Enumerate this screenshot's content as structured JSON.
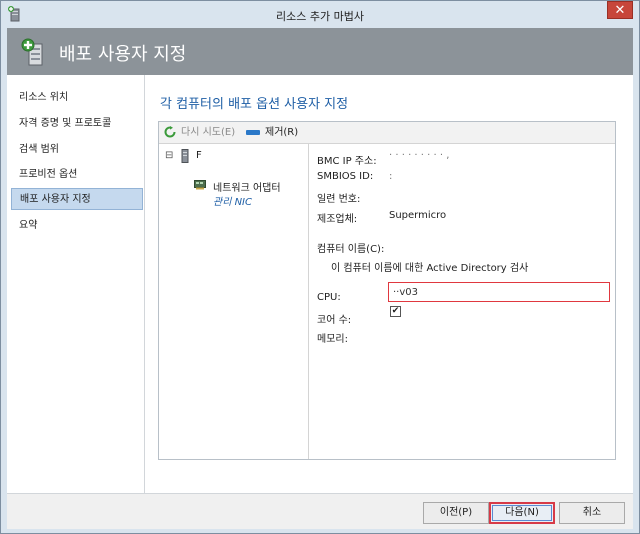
{
  "window": {
    "title": "리소스 추가 마법사",
    "close_label": "✕"
  },
  "header": {
    "title": "배포 사용자 지정"
  },
  "nav": {
    "items": [
      {
        "label": "리소스 위치"
      },
      {
        "label": "자격 증명 및 프로토콜"
      },
      {
        "label": "검색 범위"
      },
      {
        "label": "프로비전 옵션"
      },
      {
        "label": "배포 사용자 지정"
      },
      {
        "label": "요약"
      }
    ]
  },
  "main": {
    "heading": "각 컴퓨터의 배포 옵션 사용자 지정",
    "toolbar": {
      "retry_label": "다시 시도(E)",
      "remove_label": "제거(R)"
    },
    "tree": {
      "expand_symbol": "⊟",
      "server_name": "F",
      "adapter_label": "네트워크 어댑터",
      "adapter_sub": "관리 NIC"
    },
    "details": {
      "bmc_label": "BMC IP 주소:",
      "bmc_value": "· · · · · · · · ·  ,",
      "smbios_label": "SMBIOS ID:",
      "smbios_value": ":",
      "serial_label": "일련 번호:",
      "vendor_label": "제조업체:",
      "vendor_value": "Supermicro",
      "computer_name_label": "컴퓨터 이름(C):",
      "computer_name_value": "··v03",
      "ad_check_label": "이 컴퓨터 이름에 대한 Active Directory 검사",
      "ad_check_mark": "✔",
      "cpu_label": "CPU:",
      "cores_label": "코어 수:",
      "memory_label": "메모리:"
    }
  },
  "footer": {
    "back_label": "이전(P)",
    "next_label": "다음(N)",
    "cancel_label": "취소"
  },
  "colors": {
    "accent": "#1f5fa6",
    "header_band": "#8c9399",
    "highlight": "#e0383f",
    "nav_selected": "#c5d9ee"
  }
}
